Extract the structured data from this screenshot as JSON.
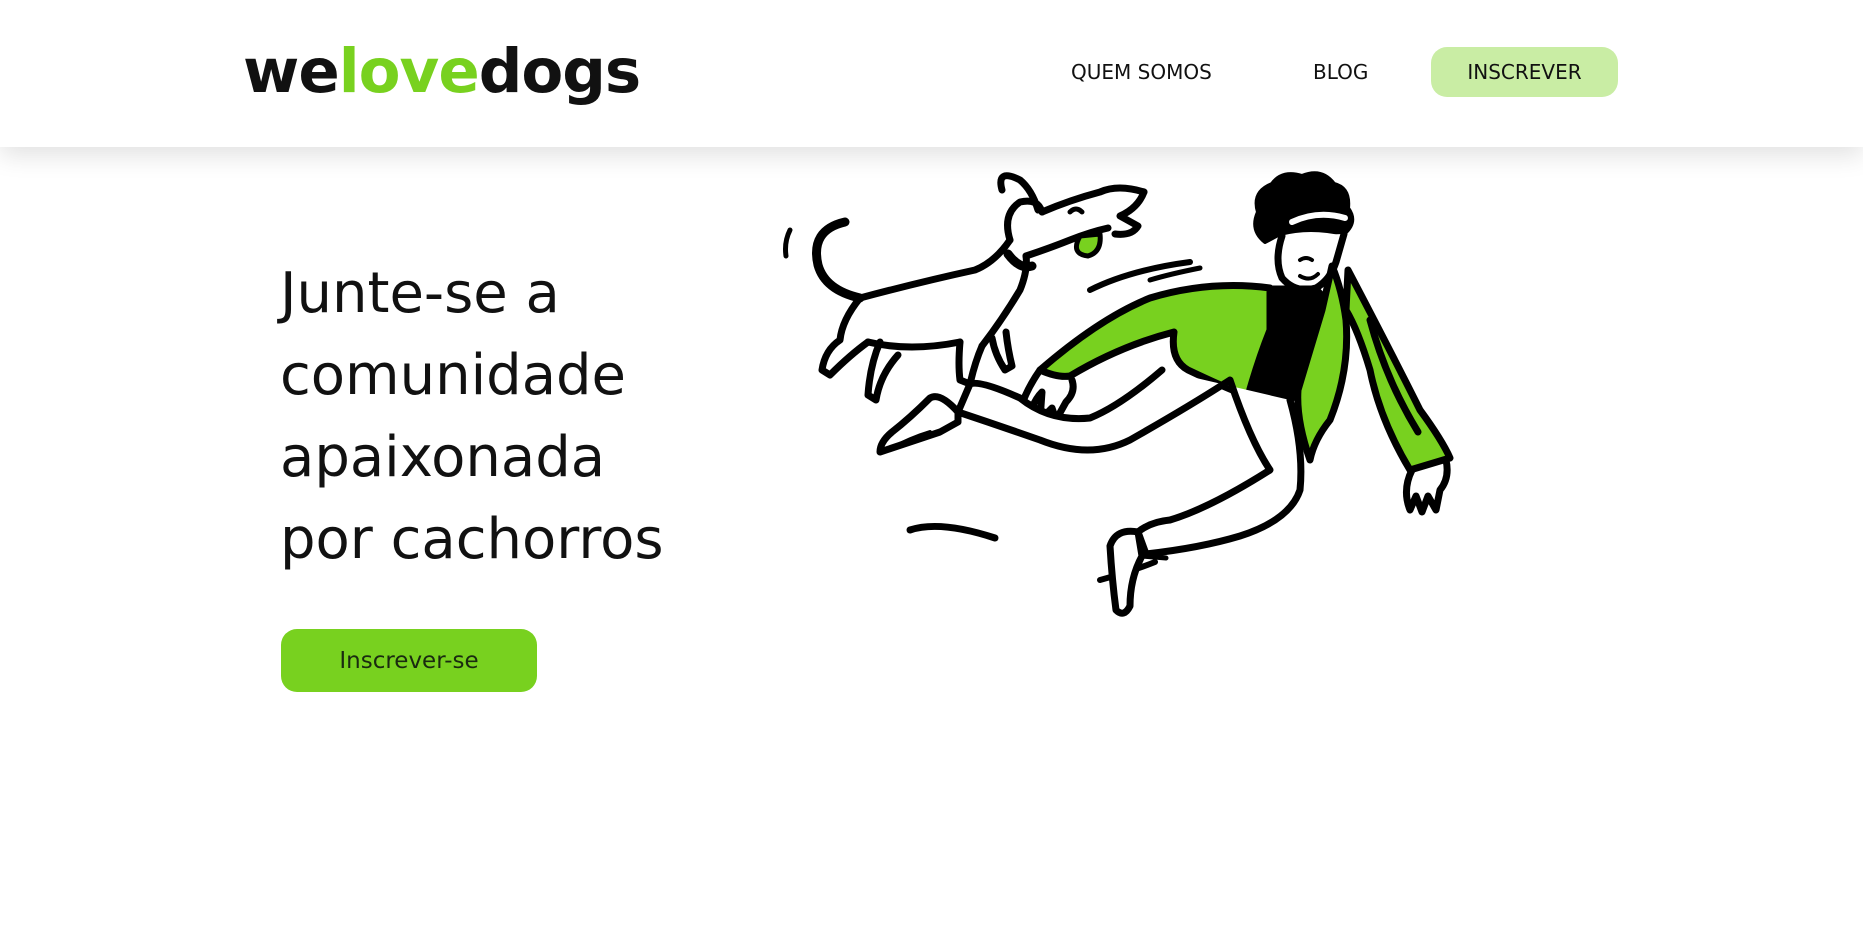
{
  "header": {
    "logo": {
      "part1": "we",
      "part2": "love",
      "part3": "dogs"
    },
    "nav": {
      "quem_somos": "QUEM SOMOS",
      "blog": "BLOG",
      "cta": "INSCREVER"
    }
  },
  "hero": {
    "title_lines": [
      "Junte-se a",
      "comunidade",
      "apaixonada",
      "por cachorros"
    ],
    "cta": "Inscrever-se",
    "illustration": {
      "icon": "person-running-with-dog-illustration"
    }
  },
  "colors": {
    "accent": "#78d11f",
    "accent_light": "#c9eda4",
    "text": "#111111",
    "background": "#ffffff"
  }
}
